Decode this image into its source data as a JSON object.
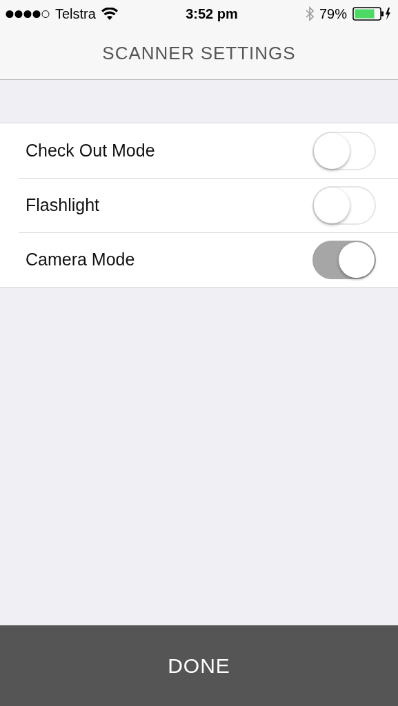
{
  "status_bar": {
    "carrier": "Telstra",
    "time": "3:52 pm",
    "battery": "79%"
  },
  "nav_bar": {
    "title": "SCANNER SETTINGS"
  },
  "settings": [
    {
      "label": "Check Out Mode",
      "on": false
    },
    {
      "label": "Flashlight",
      "on": false
    },
    {
      "label": "Camera Mode",
      "on": true
    }
  ],
  "footer_button": "DONE"
}
